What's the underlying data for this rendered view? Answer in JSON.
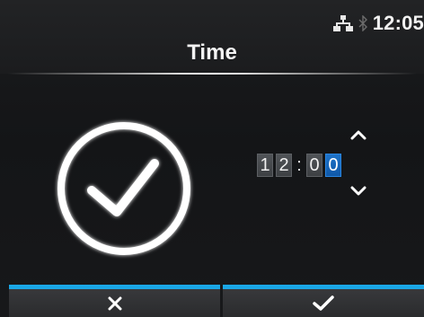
{
  "status_bar": {
    "time": "12:05",
    "network_icon": "network-icon",
    "bluetooth_icon": "bluetooth-icon"
  },
  "header": {
    "title": "Time"
  },
  "time_editor": {
    "digits": [
      "1",
      "2",
      "0",
      "0"
    ],
    "separator": ":",
    "active_digit_index": 3
  },
  "buttons": {
    "cancel_icon": "close-icon",
    "confirm_icon": "checkmark-icon"
  },
  "colors": {
    "accent": "#1aa7e6",
    "active_digit": "#0f58a8"
  }
}
